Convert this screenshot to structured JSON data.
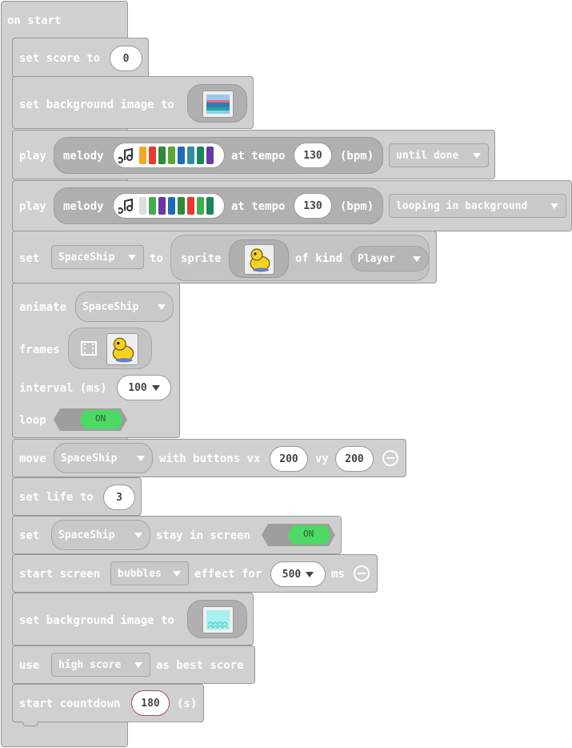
{
  "event": {
    "label": "on start"
  },
  "set_score": {
    "label": "set score to",
    "value": "0"
  },
  "set_bg1": {
    "label": "set background image to",
    "image": "ocean-background-thumbnail"
  },
  "play1": {
    "play": "play",
    "melody": "melody",
    "at_tempo": "at tempo",
    "tempo": "130",
    "bpm": "(bpm)",
    "mode": "until done",
    "notes": [
      "#f5a623",
      "#e8392e",
      "#2e8b3d",
      "#5aa832",
      "#1f6bb8",
      "#2f8f9e",
      "#18865a",
      "#6a36a8"
    ]
  },
  "play2": {
    "play": "play",
    "melody": "melody",
    "at_tempo": "at tempo",
    "tempo": "130",
    "bpm": "(bpm)",
    "mode": "looping in background",
    "notes": [
      "#dddddd",
      "#3fae4b",
      "#6a36a8",
      "#1f6bb8",
      "#2e8b3d",
      "#e8392e",
      "#3fae4b",
      "#18865a"
    ]
  },
  "set_sprite": {
    "set": "set",
    "variable": "SpaceShip",
    "to": "to",
    "sprite": "sprite",
    "of_kind": "of kind",
    "kind": "Player",
    "image": "duck-sprite"
  },
  "animate": {
    "label": "animate",
    "variable": "SpaceShip",
    "frames_label": "frames",
    "interval_label": "interval (ms)",
    "interval": "100",
    "loop_label": "loop",
    "loop_state": "ON"
  },
  "move": {
    "label": "move",
    "variable": "SpaceShip",
    "with_buttons": "with buttons vx",
    "vx": "200",
    "vy_label": "vy",
    "vy": "200"
  },
  "set_life": {
    "label": "set life to",
    "value": "3"
  },
  "stay": {
    "set": "set",
    "variable": "SpaceShip",
    "label": "stay in screen",
    "state": "ON"
  },
  "effect": {
    "label": "start screen",
    "effect": "bubbles",
    "effect_for": "effect for",
    "duration": "500",
    "ms": "ms"
  },
  "set_bg2": {
    "label": "set background image to",
    "image": "cyan-background-thumbnail"
  },
  "best": {
    "use": "use",
    "variable": "high score",
    "as_best": "as best score"
  },
  "countdown": {
    "label": "start countdown",
    "value": "180",
    "unit": "(s)"
  },
  "icons": {
    "note": "music-note-icon",
    "film": "film-strip-icon",
    "caret": "caret-down-icon",
    "remove": "minus-circle-icon"
  }
}
